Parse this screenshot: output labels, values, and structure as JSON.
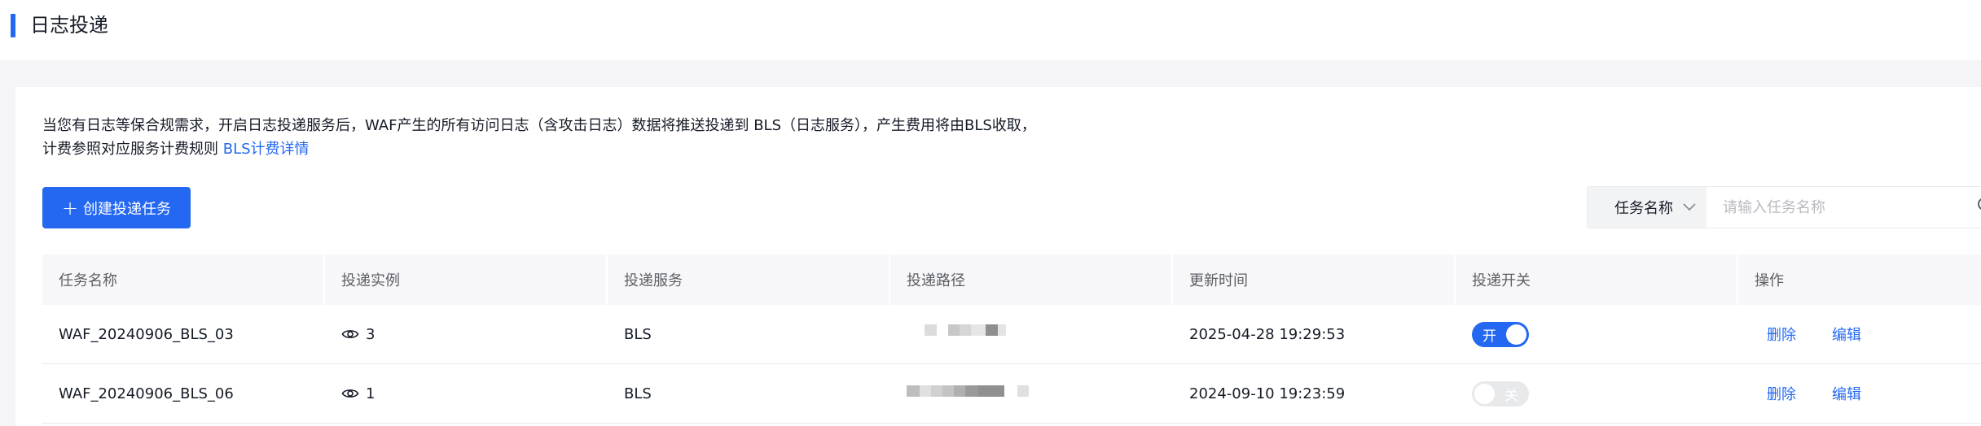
{
  "page": {
    "title": "日志投递"
  },
  "notice": {
    "line1": "当您有日志等保合规需求，开启日志投递服务后，WAF产生的所有访问日志（含攻击日志）数据将推送投递到 BLS（日志服务），产生费用将由BLS收取，",
    "line2": "计费参照对应服务计费规则 ",
    "link": "BLS计费详情"
  },
  "toolbar": {
    "create_plus": "+",
    "create_label": "创建投递任务"
  },
  "search": {
    "field_label": "任务名称",
    "placeholder": "请输入任务名称"
  },
  "table": {
    "headers": [
      "任务名称",
      "投递实例",
      "投递服务",
      "投递路径",
      "更新时间",
      "投递开关",
      "操作"
    ],
    "rows": [
      {
        "name": "WAF_20240906_BLS_03",
        "instances": "3",
        "service": "BLS",
        "updated": "2025-04-28 19:29:53",
        "switch_label": "开",
        "switch_on": true,
        "actions": [
          "删除",
          "编辑"
        ]
      },
      {
        "name": "WAF_20240906_BLS_06",
        "instances": "1",
        "service": "BLS",
        "updated": "2024-09-10 19:23:59",
        "switch_label": "关",
        "switch_on": false,
        "actions": [
          "删除",
          "编辑"
        ]
      }
    ]
  },
  "colors": {
    "accent": "#2468f2",
    "toggle_off": "#e8e9eb",
    "header_bg": "#f7f7f9"
  },
  "icons": {
    "eye": "eye-icon",
    "chevron": "chevron-down-icon",
    "search": "search-icon"
  }
}
